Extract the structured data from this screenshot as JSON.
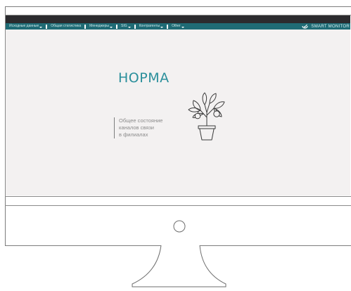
{
  "nav": {
    "items": [
      {
        "label": "Исходные данные",
        "has_dropdown": true,
        "icon": "chevron-down-icon"
      },
      {
        "label": "Общая статистика",
        "has_dropdown": false
      },
      {
        "label": "Менеджеры",
        "has_dropdown": true,
        "icon": "chevron-down-icon"
      },
      {
        "label": "SIG",
        "has_dropdown": true,
        "icon": "chevron-down-icon"
      },
      {
        "label": "Контрагенты",
        "has_dropdown": true,
        "icon": "chevron-down-icon"
      },
      {
        "label": "Other",
        "has_dropdown": true,
        "icon": "chevron-down-icon"
      }
    ]
  },
  "brand": {
    "name": "SMART MONITOR",
    "icon": "smile-check-logo-icon"
  },
  "status": {
    "title": "НОРМА",
    "description_lines": [
      "Общее состояние",
      "каналов связи",
      "в филиалах"
    ]
  },
  "illustration": {
    "icon": "potted-tree-icon"
  },
  "colors": {
    "nav_background": "#1f6b75",
    "top_bar": "#2c2b2e",
    "screen_background": "#f3f1f1",
    "accent_text": "#2a8f9b",
    "muted_text": "#8b8b8b"
  }
}
